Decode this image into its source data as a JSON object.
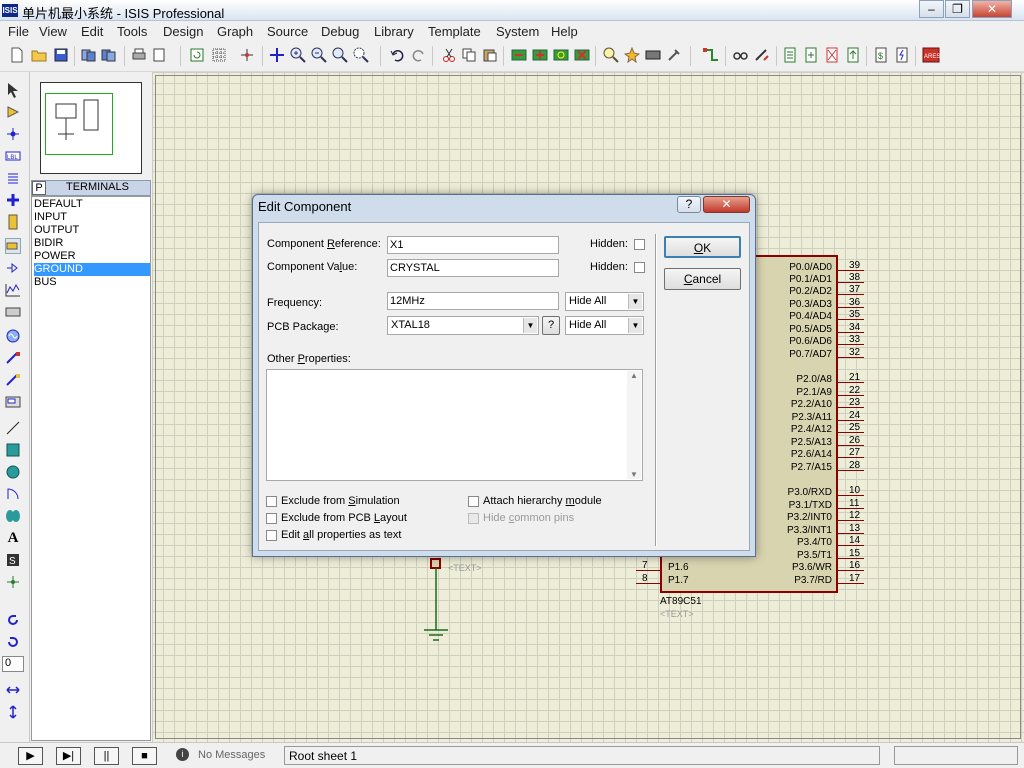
{
  "window": {
    "title": "单片机最小系统 - ISIS Professional",
    "app_icon": "ISIS"
  },
  "window_controls": {
    "minimize": "–",
    "restore": "❐",
    "close": "✕"
  },
  "menu": [
    "File",
    "View",
    "Edit",
    "Tools",
    "Design",
    "Graph",
    "Source",
    "Debug",
    "Library",
    "Template",
    "System",
    "Help"
  ],
  "left_panel": {
    "p_button": "P",
    "header": "TERMINALS",
    "items": [
      "DEFAULT",
      "INPUT",
      "OUTPUT",
      "BIDIR",
      "POWER",
      "GROUND",
      "BUS"
    ],
    "selected_index": 5
  },
  "left_tools_rotation": "0",
  "schematic": {
    "chip_name": "AT89C51",
    "chip_text": "<TEXT>",
    "crystal_text": "<TEXT>",
    "right_pins": [
      {
        "num": "39",
        "label": "P0.0/AD0"
      },
      {
        "num": "38",
        "label": "P0.1/AD1"
      },
      {
        "num": "37",
        "label": "P0.2/AD2"
      },
      {
        "num": "36",
        "label": "P0.3/AD3"
      },
      {
        "num": "35",
        "label": "P0.4/AD4"
      },
      {
        "num": "34",
        "label": "P0.5/AD5"
      },
      {
        "num": "33",
        "label": "P0.6/AD6"
      },
      {
        "num": "32",
        "label": "P0.7/AD7"
      },
      {
        "num": "21",
        "label": "P2.0/A8"
      },
      {
        "num": "22",
        "label": "P2.1/A9"
      },
      {
        "num": "23",
        "label": "P2.2/A10"
      },
      {
        "num": "24",
        "label": "P2.3/A11"
      },
      {
        "num": "25",
        "label": "P2.4/A12"
      },
      {
        "num": "26",
        "label": "P2.5/A13"
      },
      {
        "num": "27",
        "label": "P2.6/A14"
      },
      {
        "num": "28",
        "label": "P2.7/A15"
      },
      {
        "num": "10",
        "label": "P3.0/RXD"
      },
      {
        "num": "11",
        "label": "P3.1/TXD"
      },
      {
        "num": "12",
        "label": "P3.2/INT0"
      },
      {
        "num": "13",
        "label": "P3.3/INT1"
      },
      {
        "num": "14",
        "label": "P3.4/T0"
      },
      {
        "num": "15",
        "label": "P3.5/T1"
      },
      {
        "num": "16",
        "label": "P3.6/WR"
      },
      {
        "num": "17",
        "label": "P3.7/RD"
      }
    ],
    "left_pins": [
      {
        "num": "7",
        "label": "P1.6"
      },
      {
        "num": "8",
        "label": "P1.7"
      }
    ]
  },
  "status": {
    "message": "No Messages",
    "sheet": "Root sheet 1",
    "play": "▶",
    "step": "▶|",
    "pause": "||",
    "stop": "■"
  },
  "dialog": {
    "title": "Edit Component",
    "help_btn": "?",
    "close_btn": "✕",
    "ref_label_pre": "Component ",
    "ref_label_u": "R",
    "ref_label_post": "eference:",
    "ref_value": "X1",
    "val_label_pre": "Component Va",
    "val_label_u": "l",
    "val_label_post": "ue:",
    "val_value": "CRYSTAL",
    "hidden_label": "Hidden:",
    "freq_label": "Frequency:",
    "freq_value": "12MHz",
    "freq_vis": "Hide All",
    "pcb_label": "PCB Package:",
    "pcb_value": "XTAL18",
    "pcb_help": "?",
    "pcb_vis": "Hide All",
    "other_label_pre": "Other ",
    "other_label_u": "P",
    "other_label_post": "roperties:",
    "ok_u": "O",
    "ok_post": "K",
    "cancel_u": "C",
    "cancel_post": "ancel",
    "ex_sim_pre": "Exclude from ",
    "ex_sim_u": "S",
    "ex_sim_post": "imulation",
    "ex_pcb_pre": "Exclude from PCB ",
    "ex_pcb_u": "L",
    "ex_pcb_post": "ayout",
    "edit_all_pre": "Edit ",
    "edit_all_u": "a",
    "edit_all_post": "ll properties as text",
    "attach_pre": "Attach hierarchy ",
    "attach_u": "m",
    "attach_post": "odule",
    "hide_pins_pre": "Hide ",
    "hide_pins_u": "c",
    "hide_pins_post": "ommon pins"
  }
}
